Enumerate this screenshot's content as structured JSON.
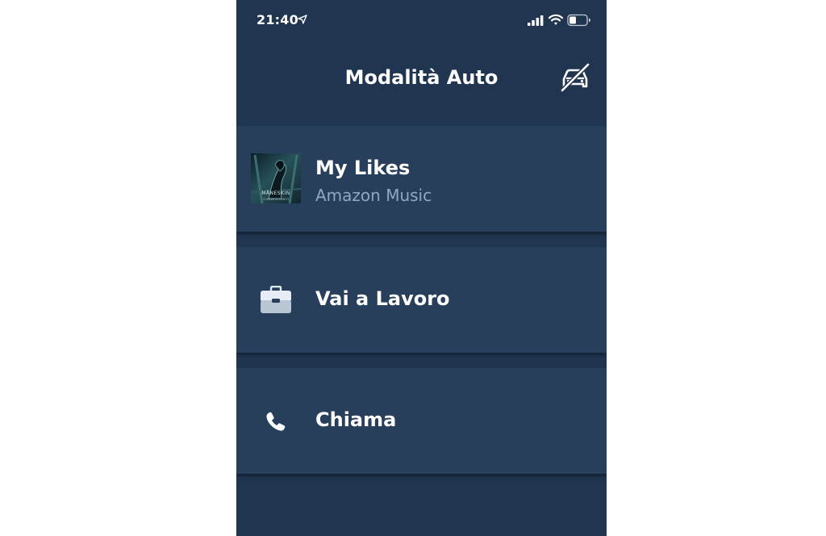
{
  "status_bar": {
    "time": "21:40",
    "icons": [
      "location-arrow-icon",
      "cellular-signal-icon",
      "wifi-icon",
      "battery-icon"
    ]
  },
  "header": {
    "title": "Modalità Auto",
    "action_icon": "car-mode-off-icon"
  },
  "cards": [
    {
      "title": "My Likes",
      "subtitle": "Amazon Music",
      "image": "album-art",
      "album_text": "MÅNESKIN",
      "album_subtext": "CORALE DI CANTO"
    },
    {
      "title": "Vai a Lavoro",
      "icon": "briefcase-icon"
    },
    {
      "title": "Chiama",
      "icon": "phone-icon"
    }
  ],
  "colors": {
    "background": "#1f3550",
    "card": "#283f5c",
    "subtitle": "#8ea8c2",
    "text": "#ffffff"
  }
}
